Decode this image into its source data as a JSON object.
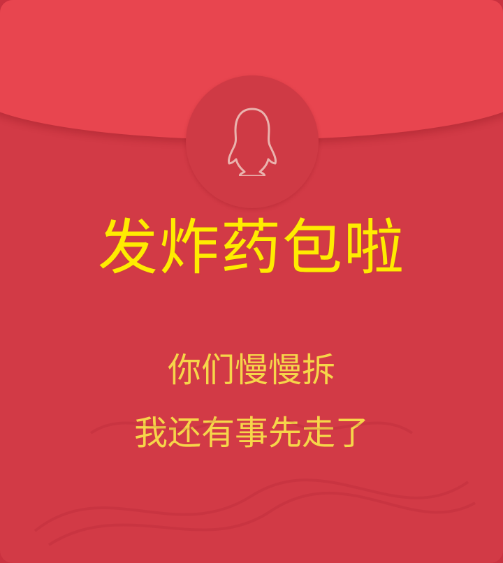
{
  "envelope": {
    "title": "发炸药包啦",
    "message_line_1": "你们慢慢拆",
    "message_line_2": "我还有事先走了",
    "seal_icon": "penguin-outline-icon"
  },
  "colors": {
    "envelope_body": "#d23a46",
    "envelope_flap": "#e8454f",
    "title_text": "#ffec00",
    "message_text": "#f6d64a"
  }
}
